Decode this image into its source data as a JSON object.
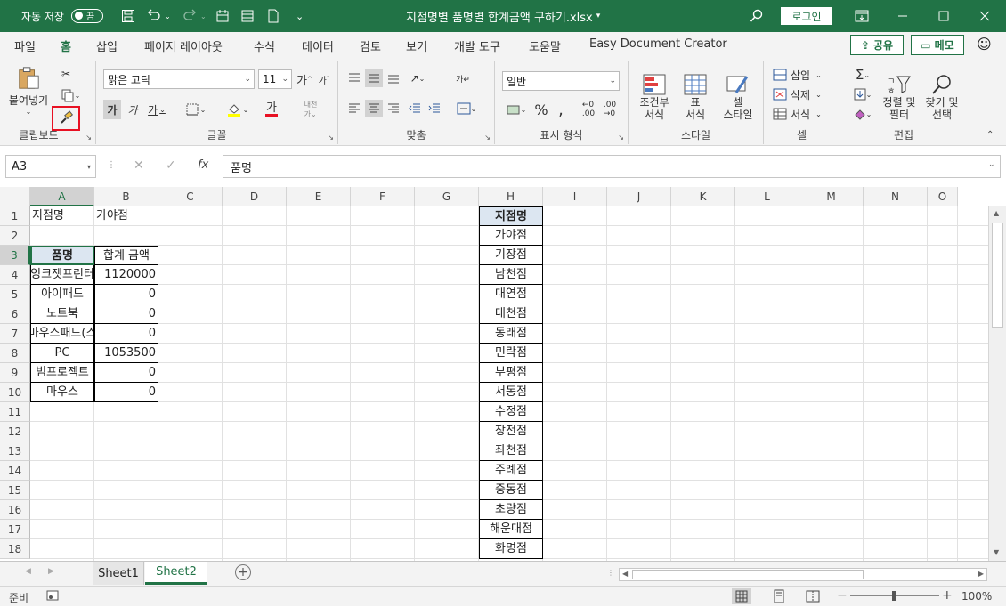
{
  "titlebar": {
    "autosave_label": "자동 저장",
    "autosave_state": "끔",
    "filename": "지점명별 품명별 합계금액 구하기.xlsx",
    "login_label": "로그인"
  },
  "menu": {
    "tabs": [
      "파일",
      "홈",
      "삽입",
      "페이지 레이아웃",
      "수식",
      "데이터",
      "검토",
      "보기",
      "개발 도구",
      "도움말",
      "Easy Document Creator"
    ],
    "active_tab": "홈",
    "share_label": "공유",
    "memo_label": "메모"
  },
  "ribbon": {
    "clipboard": {
      "label": "클립보드",
      "paste_label": "붙여넣기"
    },
    "font": {
      "label": "글꼴",
      "font_name": "맑은 고딕",
      "font_size": "11",
      "bold": "가",
      "italic": "가",
      "underline": "가",
      "fontcolor_letter": "가"
    },
    "alignment": {
      "label": "맞춤"
    },
    "number": {
      "label": "표시 형식",
      "format": "일반"
    },
    "styles": {
      "label": "스타일",
      "conditional": "조건부\n서식",
      "table": "표\n서식",
      "cell_style": "셀\n스타일"
    },
    "cells": {
      "label": "셀",
      "insert": "삽입",
      "delete": "삭제",
      "format": "서식"
    },
    "editing": {
      "label": "편집",
      "sort_filter": "정렬 및\n필터",
      "find_select": "찾기 및\n선택"
    }
  },
  "formula": {
    "name_box": "A3",
    "content": "품명"
  },
  "columns": [
    "A",
    "B",
    "C",
    "D",
    "E",
    "F",
    "G",
    "H",
    "I",
    "J",
    "K",
    "L",
    "M",
    "N",
    "O"
  ],
  "rows": [
    "1",
    "2",
    "3",
    "4",
    "5",
    "6",
    "7",
    "8",
    "9",
    "10",
    "11",
    "12",
    "13",
    "14",
    "15",
    "16",
    "17",
    "18"
  ],
  "cells": {
    "A1": "지점명",
    "B1": "가야점",
    "A3": "품명",
    "B3": "합계 금액",
    "A4": "잉크젯프린터",
    "B4": "1120000",
    "A5": "아이패드",
    "B5": "0",
    "A6": "노트북",
    "B6": "0",
    "A7": "마우스패드(스",
    "B7": "0",
    "A8": "PC",
    "B8": "1053500",
    "A9": "빔프로젝트",
    "B9": "0",
    "A10": "마우스",
    "B10": "0",
    "H1": "지점명",
    "H2": "가야점",
    "H3": "기장점",
    "H4": "남천점",
    "H5": "대연점",
    "H6": "대천점",
    "H7": "동래점",
    "H8": "민락점",
    "H9": "부평점",
    "H10": "서동점",
    "H11": "수정점",
    "H12": "장전점",
    "H13": "좌천점",
    "H14": "주례점",
    "H15": "중동점",
    "H16": "초량점",
    "H17": "해운대점",
    "H18": "화명점"
  },
  "sheets": {
    "tabs": [
      "Sheet1",
      "Sheet2"
    ],
    "active": "Sheet2"
  },
  "status": {
    "ready": "준비",
    "zoom": "100%"
  },
  "colors": {
    "excel_green": "#217346",
    "header_fill": "#dce6f1",
    "highlight_box": "#e81123"
  }
}
